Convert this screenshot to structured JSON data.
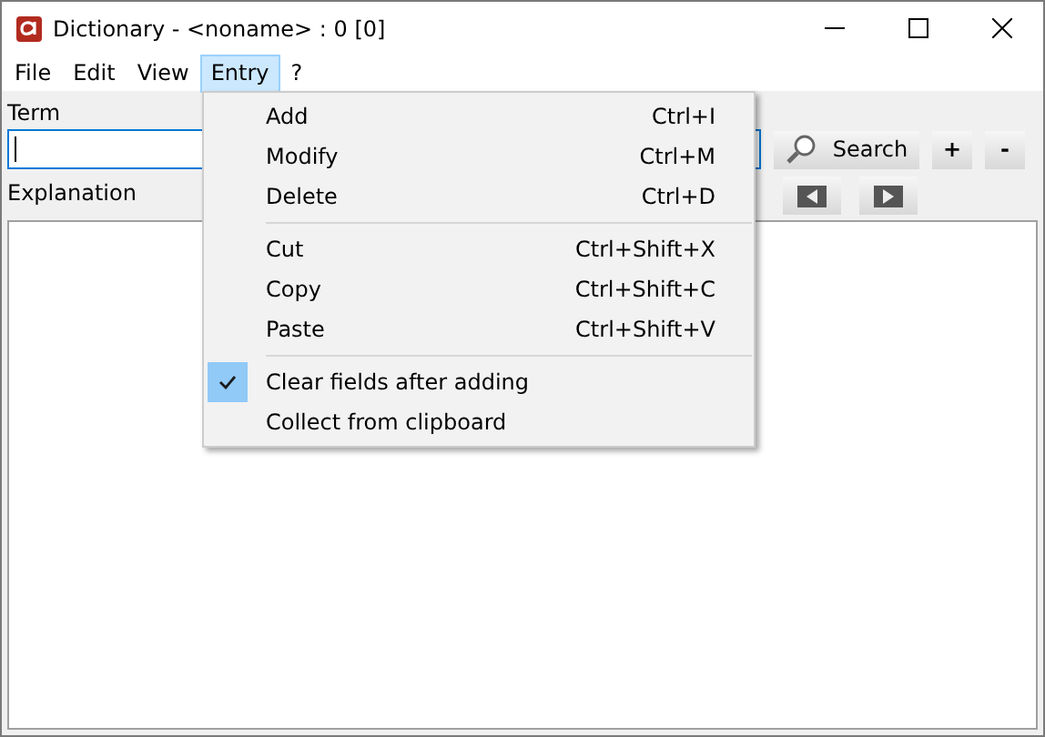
{
  "window": {
    "title": "Dictionary - <noname> : 0 [0]"
  },
  "menu_bar": [
    {
      "label": "File",
      "selected": false
    },
    {
      "label": "Edit",
      "selected": false
    },
    {
      "label": "View",
      "selected": false
    },
    {
      "label": "Entry",
      "selected": true
    },
    {
      "label": "?",
      "selected": false
    }
  ],
  "term": {
    "label": "Term"
  },
  "buttons": {
    "search": "Search",
    "add": "+",
    "remove": "-"
  },
  "explanation": {
    "label": "Explanation"
  },
  "entry_menu": [
    {
      "kind": "item",
      "label": "Add",
      "shortcut": "Ctrl+I",
      "checked": false
    },
    {
      "kind": "item",
      "label": "Modify",
      "shortcut": "Ctrl+M",
      "checked": false
    },
    {
      "kind": "item",
      "label": "Delete",
      "shortcut": "Ctrl+D",
      "checked": false
    },
    {
      "kind": "separator"
    },
    {
      "kind": "item",
      "label": "Cut",
      "shortcut": "Ctrl+Shift+X",
      "checked": false
    },
    {
      "kind": "item",
      "label": "Copy",
      "shortcut": "Ctrl+Shift+C",
      "checked": false
    },
    {
      "kind": "item",
      "label": "Paste",
      "shortcut": "Ctrl+Shift+V",
      "checked": false
    },
    {
      "kind": "separator"
    },
    {
      "kind": "item",
      "label": "Clear fields after adding",
      "checked": true
    },
    {
      "kind": "item",
      "label": "Collect from clipboard",
      "checked": false
    }
  ]
}
